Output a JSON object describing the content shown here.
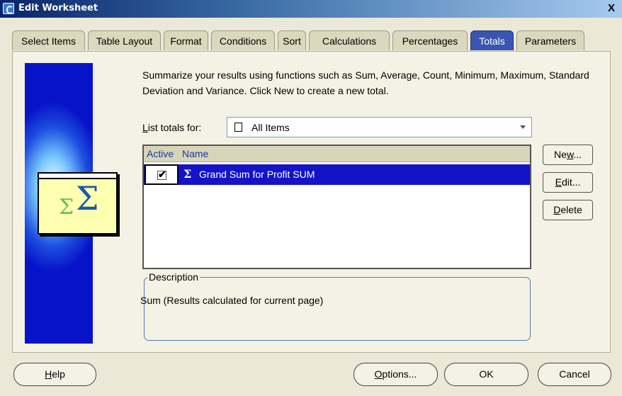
{
  "window": {
    "title": "Edit Worksheet",
    "close_glyph": "X"
  },
  "tabs": [
    {
      "label": "Select Items",
      "active": false
    },
    {
      "label": "Table Layout",
      "active": false
    },
    {
      "label": "Format",
      "active": false
    },
    {
      "label": "Conditions",
      "active": false
    },
    {
      "label": "Sort",
      "active": false
    },
    {
      "label": "Calculations",
      "active": false
    },
    {
      "label": "Percentages",
      "active": false
    },
    {
      "label": "Totals",
      "active": true
    },
    {
      "label": "Parameters",
      "active": false
    }
  ],
  "summary_text": "Summarize your results using functions such as Sum, Average, Count, Minimum, Maximum, Standard Deviation and Variance. Click New to create a new total.",
  "list_totals": {
    "label_pre": "",
    "label_key": "L",
    "label_post": "ist totals for:",
    "selected": "All Items"
  },
  "table": {
    "columns": [
      "Active",
      "Name"
    ],
    "rows": [
      {
        "active": true,
        "name": "Grand Sum for Profit SUM"
      }
    ]
  },
  "side_buttons": [
    {
      "pre": "Ne",
      "key": "w",
      "post": "..."
    },
    {
      "pre": "",
      "key": "E",
      "post": "dit..."
    },
    {
      "pre": "",
      "key": "D",
      "post": "elete"
    }
  ],
  "description": {
    "legend": "Description",
    "text": "Sum (Results calculated for current page)"
  },
  "bottom_buttons": {
    "help": {
      "pre": "",
      "key": "H",
      "post": "elp"
    },
    "options": {
      "pre": "",
      "key": "O",
      "post": "ptions..."
    },
    "ok": "OK",
    "cancel": "Cancel"
  },
  "colors": {
    "selected_row": "#1313c9",
    "active_tab": "#3a55b0",
    "background": "#ebe8d8"
  }
}
